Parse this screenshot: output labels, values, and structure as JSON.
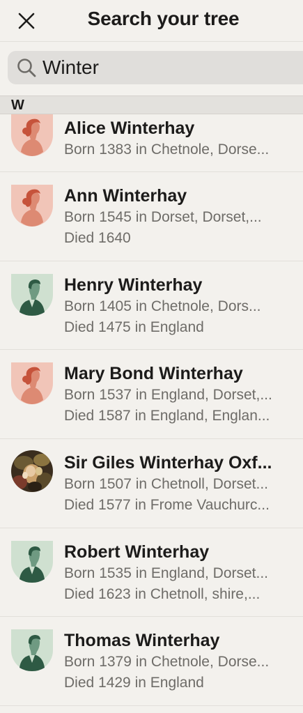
{
  "header": {
    "title": "Search your tree"
  },
  "search": {
    "value": "Winter"
  },
  "section": {
    "letter": "W"
  },
  "results": [
    {
      "name": "Alice Winterhay",
      "born": "Born 1383 in Chetnole, Dorse...",
      "died": "",
      "avatar": "female-silhouette-icon"
    },
    {
      "name": "Ann Winterhay",
      "born": "Born 1545 in Dorset, Dorset,...",
      "died": "Died 1640",
      "avatar": "female-silhouette-icon"
    },
    {
      "name": "Henry Winterhay",
      "born": "Born 1405 in Chetnole, Dors...",
      "died": "Died 1475 in England",
      "avatar": "male-silhouette-icon"
    },
    {
      "name": "Mary Bond Winterhay",
      "born": "Born 1537 in England, Dorset,...",
      "died": "Died 1587 in England, Englan...",
      "avatar": "female-silhouette-icon"
    },
    {
      "name": "Sir Giles Winterhay Oxf...",
      "born": "Born 1507 in Chetnoll, Dorset...",
      "died": "Died 1577 in Frome Vauchurc...",
      "avatar": "portrait-photo"
    },
    {
      "name": "Robert Winterhay",
      "born": "Born 1535 in England, Dorset...",
      "died": "Died 1623 in Chetnoll, shire,...",
      "avatar": "male-silhouette-icon"
    },
    {
      "name": "Thomas Winterhay",
      "born": "Born 1379 in Chetnole, Dorse...",
      "died": "Died 1429 in England",
      "avatar": "male-silhouette-icon"
    }
  ],
  "colors": {
    "female_bg": "#f1c5b8",
    "female_fig": "#dd8a73",
    "female_hair": "#c6533b",
    "male_bg": "#cfe0d0",
    "male_fig": "#2e5a44",
    "male_face": "#6f9a82"
  }
}
